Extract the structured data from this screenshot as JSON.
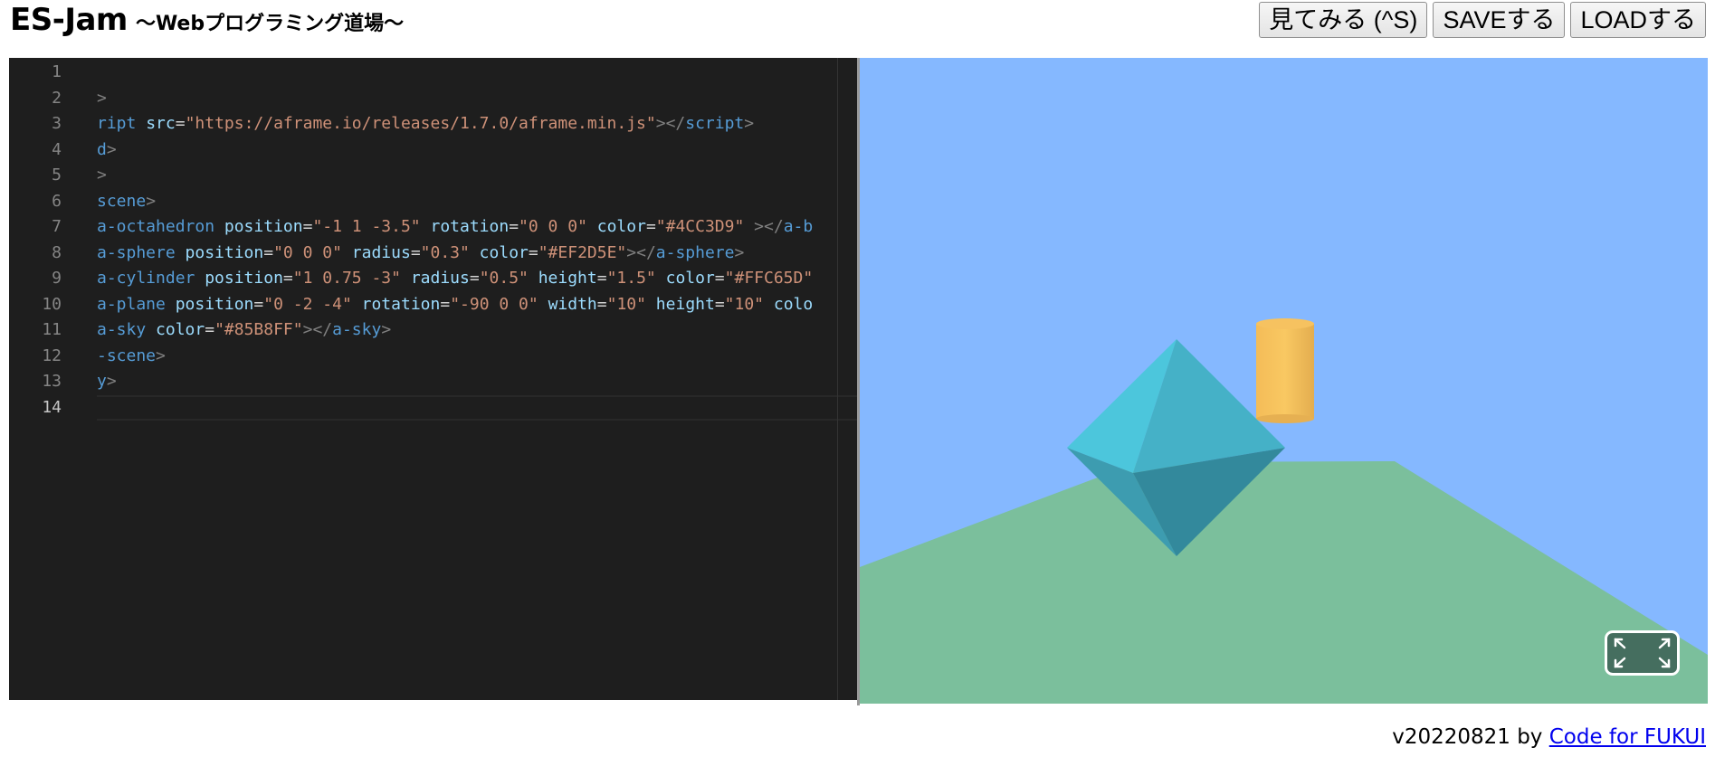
{
  "header": {
    "title": "ES-Jam",
    "subtitle": "〜Webプログラミング道場〜"
  },
  "toolbar": {
    "view_label": "見てみる (^S)",
    "save_label": "SAVEする",
    "load_label": "LOADする"
  },
  "editor": {
    "active_line": 14,
    "line_numbers": [
      "1",
      "2",
      "3",
      "4",
      "5",
      "6",
      "7",
      "8",
      "9",
      "10",
      "11",
      "12",
      "13",
      "14"
    ],
    "lines": [
      [],
      [
        {
          "t": ">",
          "c": "punct"
        }
      ],
      [
        {
          "t": "ript",
          "c": "tag"
        },
        {
          "t": " src",
          "c": "attr"
        },
        {
          "t": "=",
          "c": "eq"
        },
        {
          "t": "\"https://aframe.io/releases/1.7.0/aframe.min.js\"",
          "c": "str"
        },
        {
          "t": "></",
          "c": "punct"
        },
        {
          "t": "script",
          "c": "tag"
        },
        {
          "t": ">",
          "c": "punct"
        }
      ],
      [
        {
          "t": "d",
          "c": "tag"
        },
        {
          "t": ">",
          "c": "punct"
        }
      ],
      [
        {
          "t": ">",
          "c": "punct"
        }
      ],
      [
        {
          "t": "scene",
          "c": "tag"
        },
        {
          "t": ">",
          "c": "punct"
        }
      ],
      [
        {
          "t": "a-octahedron",
          "c": "tag"
        },
        {
          "t": " position",
          "c": "attr"
        },
        {
          "t": "=",
          "c": "eq"
        },
        {
          "t": "\"-1 1 -3.5\"",
          "c": "str"
        },
        {
          "t": " rotation",
          "c": "attr"
        },
        {
          "t": "=",
          "c": "eq"
        },
        {
          "t": "\"0 0 0\"",
          "c": "str"
        },
        {
          "t": " color",
          "c": "attr"
        },
        {
          "t": "=",
          "c": "eq"
        },
        {
          "t": "\"#4CC3D9\"",
          "c": "str"
        },
        {
          "t": " ></",
          "c": "punct"
        },
        {
          "t": "a-b",
          "c": "tag"
        }
      ],
      [
        {
          "t": "a-sphere",
          "c": "tag"
        },
        {
          "t": " position",
          "c": "attr"
        },
        {
          "t": "=",
          "c": "eq"
        },
        {
          "t": "\"0 0 0\"",
          "c": "str"
        },
        {
          "t": " radius",
          "c": "attr"
        },
        {
          "t": "=",
          "c": "eq"
        },
        {
          "t": "\"0.3\"",
          "c": "str"
        },
        {
          "t": " color",
          "c": "attr"
        },
        {
          "t": "=",
          "c": "eq"
        },
        {
          "t": "\"#EF2D5E\"",
          "c": "str"
        },
        {
          "t": "></",
          "c": "punct"
        },
        {
          "t": "a-sphere",
          "c": "tag"
        },
        {
          "t": ">",
          "c": "punct"
        }
      ],
      [
        {
          "t": "a-cylinder",
          "c": "tag"
        },
        {
          "t": " position",
          "c": "attr"
        },
        {
          "t": "=",
          "c": "eq"
        },
        {
          "t": "\"1 0.75 -3\"",
          "c": "str"
        },
        {
          "t": " radius",
          "c": "attr"
        },
        {
          "t": "=",
          "c": "eq"
        },
        {
          "t": "\"0.5\"",
          "c": "str"
        },
        {
          "t": " height",
          "c": "attr"
        },
        {
          "t": "=",
          "c": "eq"
        },
        {
          "t": "\"1.5\"",
          "c": "str"
        },
        {
          "t": " color",
          "c": "attr"
        },
        {
          "t": "=",
          "c": "eq"
        },
        {
          "t": "\"#FFC65D\"",
          "c": "str"
        }
      ],
      [
        {
          "t": "a-plane",
          "c": "tag"
        },
        {
          "t": " position",
          "c": "attr"
        },
        {
          "t": "=",
          "c": "eq"
        },
        {
          "t": "\"0 -2 -4\"",
          "c": "str"
        },
        {
          "t": " rotation",
          "c": "attr"
        },
        {
          "t": "=",
          "c": "eq"
        },
        {
          "t": "\"-90 0 0\"",
          "c": "str"
        },
        {
          "t": " width",
          "c": "attr"
        },
        {
          "t": "=",
          "c": "eq"
        },
        {
          "t": "\"10\"",
          "c": "str"
        },
        {
          "t": " height",
          "c": "attr"
        },
        {
          "t": "=",
          "c": "eq"
        },
        {
          "t": "\"10\"",
          "c": "str"
        },
        {
          "t": " colo",
          "c": "attr"
        }
      ],
      [
        {
          "t": "a-sky",
          "c": "tag"
        },
        {
          "t": " color",
          "c": "attr"
        },
        {
          "t": "=",
          "c": "eq"
        },
        {
          "t": "\"#85B8FF\"",
          "c": "str"
        },
        {
          "t": "></",
          "c": "punct"
        },
        {
          "t": "a-sky",
          "c": "tag"
        },
        {
          "t": ">",
          "c": "punct"
        }
      ],
      [
        {
          "t": "-scene",
          "c": "tag"
        },
        {
          "t": ">",
          "c": "punct"
        }
      ],
      [
        {
          "t": "y",
          "c": "tag"
        },
        {
          "t": ">",
          "c": "punct"
        }
      ],
      []
    ]
  },
  "preview": {
    "sky_color": "#85B8FF",
    "ground_color": "#7BBF9C",
    "octahedron_color": "#4CC3D9",
    "cylinder_color": "#FFC65D",
    "vr_button_icon": "fullscreen-enter-icon"
  },
  "footer": {
    "version": "v20220821 by ",
    "link_text": "Code for FUKUI"
  }
}
